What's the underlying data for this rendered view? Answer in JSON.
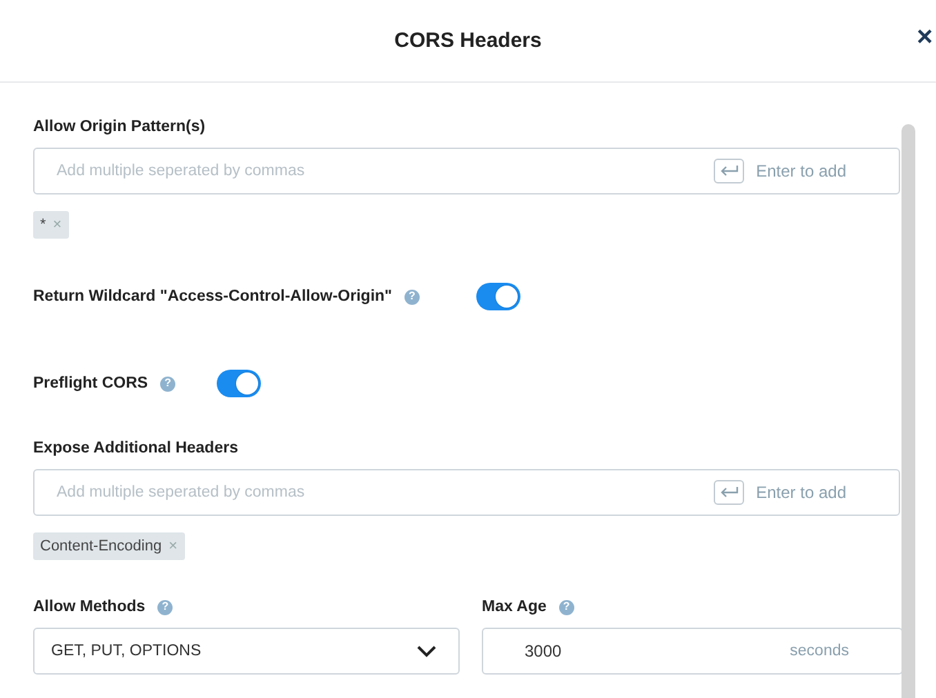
{
  "dialog": {
    "title": "CORS Headers",
    "close": "×"
  },
  "origin_patterns": {
    "label": "Allow Origin Pattern(s)",
    "placeholder": "Add multiple seperated by commas",
    "hint": "Enter to add",
    "tags": [
      {
        "text": "*",
        "remove": "×"
      }
    ]
  },
  "wildcard": {
    "label": "Return Wildcard \"Access-Control-Allow-Origin\"",
    "help": "?",
    "on": true
  },
  "preflight": {
    "label": "Preflight CORS",
    "help": "?",
    "on": true
  },
  "expose_headers": {
    "label": "Expose Additional Headers",
    "placeholder": "Add multiple seperated by commas",
    "hint": "Enter to add",
    "tags": [
      {
        "text": "Content-Encoding",
        "remove": "×"
      }
    ]
  },
  "allow_methods": {
    "label": "Allow Methods",
    "help": "?",
    "value": "GET, PUT, OPTIONS"
  },
  "max_age": {
    "label": "Max Age",
    "help": "?",
    "value": "3000",
    "unit": "seconds"
  }
}
